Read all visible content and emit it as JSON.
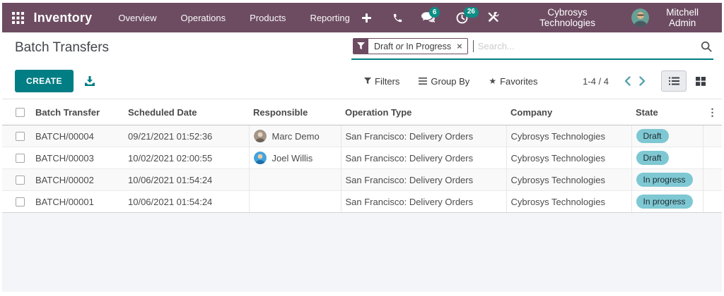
{
  "navbar": {
    "app_name": "Inventory",
    "menus": [
      {
        "label": "Overview"
      },
      {
        "label": "Operations"
      },
      {
        "label": "Products"
      },
      {
        "label": "Reporting"
      }
    ],
    "messages_badge": "6",
    "activities_badge": "26",
    "company": "Cybrosys Technologies",
    "user_name": "Mitchell Admin"
  },
  "page": {
    "title": "Batch Transfers"
  },
  "search": {
    "facet": {
      "part1": "Draft",
      "or_word": "or",
      "part2": "In Progress"
    },
    "placeholder": "Search..."
  },
  "controls": {
    "create_label": "CREATE",
    "filters_label": "Filters",
    "group_by_label": "Group By",
    "favorites_label": "Favorites",
    "pager": "1-4 / 4"
  },
  "table": {
    "headers": [
      "Batch Transfer",
      "Scheduled Date",
      "Responsible",
      "Operation Type",
      "Company",
      "State"
    ],
    "rows": [
      {
        "name": "BATCH/00004",
        "scheduled_date": "09/21/2021 01:52:36",
        "responsible": "Marc Demo",
        "operation_type": "San Francisco: Delivery Orders",
        "company": "Cybrosys Technologies",
        "state": "Draft"
      },
      {
        "name": "BATCH/00003",
        "scheduled_date": "10/02/2021 02:00:55",
        "responsible": "Joel Willis",
        "operation_type": "San Francisco: Delivery Orders",
        "company": "Cybrosys Technologies",
        "state": "Draft"
      },
      {
        "name": "BATCH/00002",
        "scheduled_date": "10/06/2021 01:54:24",
        "responsible": "",
        "operation_type": "San Francisco: Delivery Orders",
        "company": "Cybrosys Technologies",
        "state": "In progress"
      },
      {
        "name": "BATCH/00001",
        "scheduled_date": "10/06/2021 01:54:24",
        "responsible": "",
        "operation_type": "San Francisco: Delivery Orders",
        "company": "Cybrosys Technologies",
        "state": "In progress"
      }
    ]
  },
  "icons": {
    "close": "×",
    "dots": "⋮",
    "star": "★"
  },
  "colors": {
    "navbar_bg": "#6d4c62",
    "accent_teal": "#017e84",
    "nav_badge_bg": "#0b8e86",
    "state_badge_bg": "#7ec8d3",
    "facet_purple": "#6d4c62",
    "empty_area_bg": "#f4f5f8"
  }
}
